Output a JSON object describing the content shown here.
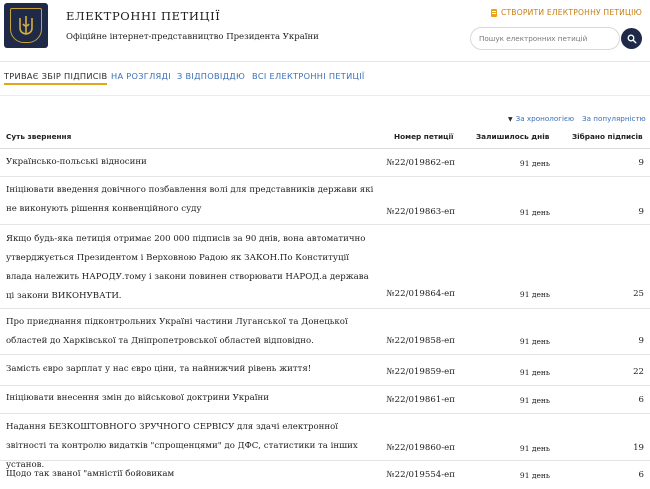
{
  "header": {
    "title": "ЕЛЕКТРОННІ ПЕТИЦІЇ",
    "subtitle": "Офіційне інтернет-представництво Президента України",
    "create_label": "СТВОРИТИ ЕЛЕКТРОННУ ПЕТИЦІЮ",
    "search_placeholder": "Пошук електронних петицій"
  },
  "tabs": [
    {
      "label": "ТРИВАЄ ЗБІР ПІДПИСІВ",
      "active": true
    },
    {
      "label": "НА РОЗГЛЯДІ",
      "active": false
    },
    {
      "label": "З ВІДПОВІДДЮ",
      "active": false
    },
    {
      "label": "ВСІ ЕЛЕКТРОННІ ПЕТИЦІЇ",
      "active": false
    }
  ],
  "sort": {
    "chronology": "За хронологією",
    "popularity": "За популярністю"
  },
  "table": {
    "columns": [
      "Суть звернення",
      "Номер петиції",
      "Залишилось днів",
      "Зібрано підписів"
    ],
    "rows": [
      {
        "subject": "Українсько-польські відносини",
        "number": "№22/019862-еп",
        "days": "91 день",
        "signatures": "9"
      },
      {
        "subject": "Ініціювати введення довічного позбавлення волі для представників держави які не виконують рішення конвенційного суду",
        "number": "№22/019863-еп",
        "days": "91 день",
        "signatures": "9"
      },
      {
        "subject": "Якщо будь-яка петиція отримає 200 000 підписів за 90 днів, вона автоматично утверджується Президентом і Верховною Радою як ЗАКОН.По Конституції влада належить НАРОДУ.тому і закони повинен створювати НАРОД.а держава ці закони ВИКОНУВАТИ.",
        "number": "№22/019864-еп",
        "days": "91 день",
        "signatures": "25"
      },
      {
        "subject": "Про приєднання підконтрольних Україні частини Луганської та Донецької областей до Харківської та Дніпропетровської областей відповідно.",
        "number": "№22/019858-еп",
        "days": "91 день",
        "signatures": "9"
      },
      {
        "subject": "Замість євро зарплат у нас євро ціни, та найнижчий рівень життя!",
        "number": "№22/019859-еп",
        "days": "91 день",
        "signatures": "22"
      },
      {
        "subject": "Ініціювати внесення змін до військової доктрини України",
        "number": "№22/019861-еп",
        "days": "91 день",
        "signatures": "6"
      },
      {
        "subject": "Надання БЕЗКОШТОВНОГО ЗРУЧНОГО СЕРВІСУ для здачі електронної звітності та контролю видатків \"спрощенцями\" до ДФС, статистики та інших установ.",
        "number": "№22/019860-еп",
        "days": "91 день",
        "signatures": "19"
      },
      {
        "subject": "Щодо так званої \"амністії бойовикам",
        "number": "№22/019554-еп",
        "days": "91 день",
        "signatures": "6"
      }
    ]
  },
  "colors": {
    "brand_navy": "#1e2a47",
    "accent_gold": "#e3a51c",
    "link_blue": "#3b6fb6",
    "create_orange": "#c87b12"
  }
}
